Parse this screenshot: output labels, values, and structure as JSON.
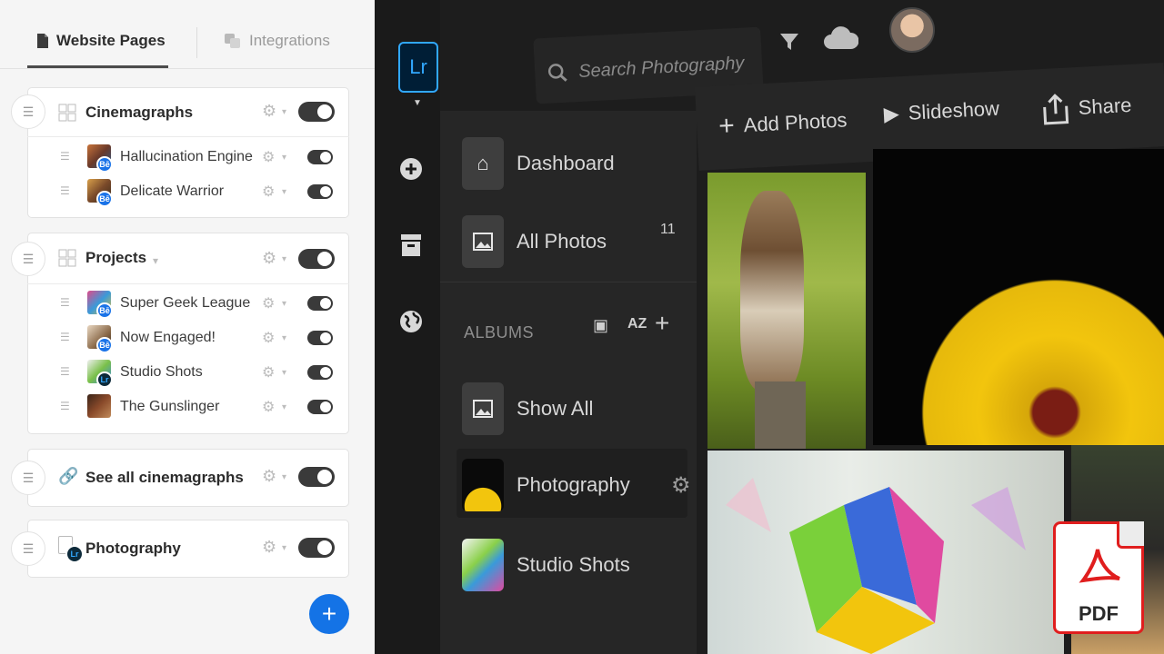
{
  "website_panel": {
    "tabs": [
      {
        "label": "Website Pages",
        "active": true
      },
      {
        "label": "Integrations",
        "active": false
      }
    ],
    "sections": [
      {
        "title": "Cinemagraphs",
        "enabled": true,
        "items": [
          {
            "label": "Hallucination Engine",
            "source": "Bē",
            "enabled": true
          },
          {
            "label": "Delicate Warrior",
            "source": "Bē",
            "enabled": true
          }
        ]
      },
      {
        "title": "Projects",
        "enabled": true,
        "items": [
          {
            "label": "Super Geek League",
            "source": "Bē",
            "enabled": true
          },
          {
            "label": "Now Engaged!",
            "source": "Bē",
            "enabled": true
          },
          {
            "label": "Studio Shots",
            "source": "Lr",
            "enabled": true
          },
          {
            "label": "The Gunslinger",
            "source": "",
            "enabled": true
          }
        ]
      },
      {
        "title": "See all cinemagraphs",
        "enabled": true,
        "items": []
      },
      {
        "title": "Photography",
        "source": "Lr",
        "enabled": true,
        "items": []
      }
    ],
    "add_button": "+"
  },
  "lightroom": {
    "logo": "Lr",
    "search_placeholder": "Search Photography",
    "toolbar": {
      "add_photos": "Add Photos",
      "slideshow": "Slideshow",
      "share": "Share"
    },
    "nav": {
      "dashboard": "Dashboard",
      "all_photos": "All Photos",
      "all_photos_count": "11"
    },
    "albums": {
      "header": "ALBUMS",
      "sort_label": "AZ",
      "items": [
        {
          "label": "Show All"
        },
        {
          "label": "Photography",
          "selected": true
        },
        {
          "label": "Studio Shots"
        }
      ]
    }
  },
  "pdf_badge": {
    "label": "PDF"
  },
  "colors": {
    "accent_blue": "#1473e6",
    "lr_blue": "#31a8ff",
    "pdf_red": "#e01e1e"
  }
}
